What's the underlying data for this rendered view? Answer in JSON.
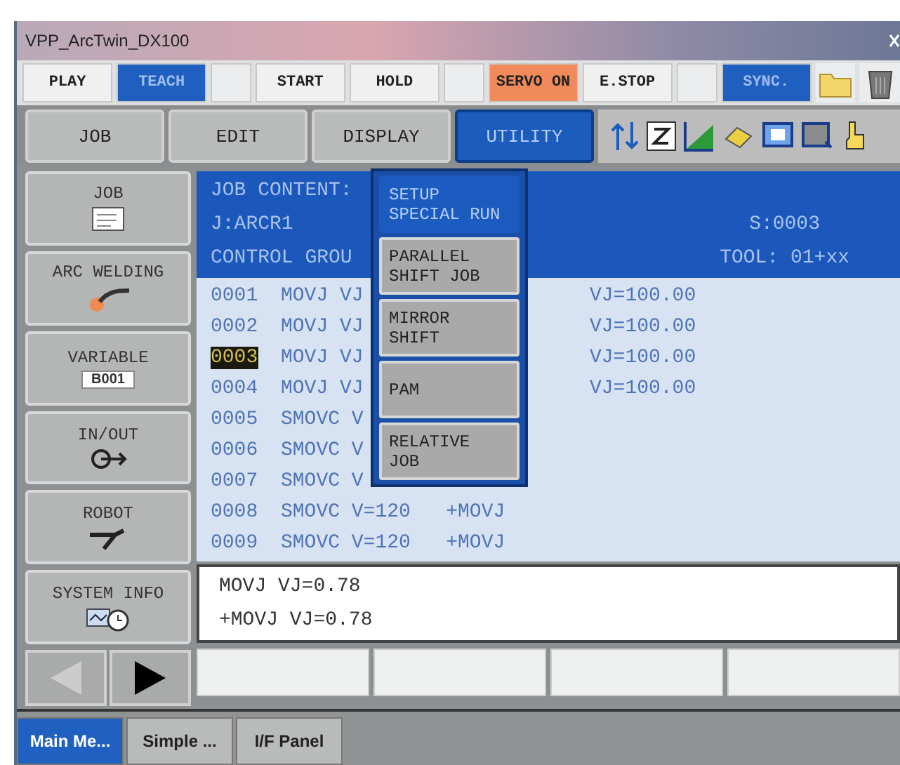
{
  "window": {
    "title": "VPP_ArcTwin_DX100"
  },
  "status_buttons": [
    {
      "kind": "plain",
      "label": "PLAY",
      "selected": false
    },
    {
      "kind": "plain",
      "label": "TEACH",
      "selected": true
    },
    {
      "kind": "spacer"
    },
    {
      "kind": "plain",
      "label": "START",
      "selected": false
    },
    {
      "kind": "plain",
      "label": "HOLD",
      "selected": false
    },
    {
      "kind": "spacer"
    },
    {
      "kind": "servo",
      "label": "SERVO ON",
      "selected": true
    },
    {
      "kind": "plain",
      "label": "E.STOP",
      "selected": false
    },
    {
      "kind": "spacer"
    },
    {
      "kind": "plain",
      "label": "SYNC.",
      "selected": true
    },
    {
      "kind": "folder"
    },
    {
      "kind": "bin"
    }
  ],
  "menu_tabs": [
    {
      "label": "JOB",
      "selected": false
    },
    {
      "label": "EDIT",
      "selected": false
    },
    {
      "label": "DISPLAY",
      "selected": false
    },
    {
      "label": "UTILITY",
      "selected": true
    }
  ],
  "side_buttons": [
    {
      "kind": "job",
      "label": "JOB"
    },
    {
      "kind": "arc",
      "label": "ARC WELDING"
    },
    {
      "kind": "variable",
      "label": "VARIABLE",
      "badge": "B001"
    },
    {
      "kind": "inout",
      "label": "IN/OUT"
    },
    {
      "kind": "robot",
      "label": "ROBOT"
    },
    {
      "kind": "sysinfo",
      "label": "SYSTEM INFO"
    }
  ],
  "job": {
    "header_left": [
      "JOB CONTENT:",
      "J:ARCR1",
      "CONTROL GROU"
    ],
    "header_right": [
      "S:0003",
      "TOOL: 01+xx"
    ],
    "lines": [
      {
        "number": "0001",
        "text": "MOVJ VJ",
        "tail": "VJ=100.00",
        "selected": false
      },
      {
        "number": "0002",
        "text": "MOVJ VJ",
        "tail": "VJ=100.00",
        "selected": false
      },
      {
        "number": "0003",
        "text": "MOVJ VJ",
        "tail": "VJ=100.00",
        "selected": true
      },
      {
        "number": "0004",
        "text": "MOVJ VJ",
        "tail": "VJ=100.00",
        "selected": false
      },
      {
        "number": "0005",
        "text": "SMOVC V",
        "selected": false
      },
      {
        "number": "0006",
        "text": "SMOVC V",
        "selected": false
      },
      {
        "number": "0007",
        "text": "SMOVC V",
        "selected": false
      },
      {
        "number": "0008",
        "text": "SMOVC V=120   +MOVJ",
        "selected": false
      },
      {
        "number": "0009",
        "text": "SMOVC V=120   +MOVJ",
        "selected": false
      }
    ]
  },
  "utility_menu": [
    {
      "label": "SETUP\nSPECIAL RUN",
      "selected": true
    },
    {
      "label": "PARALLEL\nSHIFT JOB",
      "selected": false
    },
    {
      "label": "MIRROR\nSHIFT",
      "selected": false
    },
    {
      "label": "PAM",
      "selected": false
    },
    {
      "label": "RELATIVE\nJOB",
      "selected": false
    }
  ],
  "input_lines": [
    "MOVJ VJ=0.78",
    "+MOVJ VJ=0.78"
  ],
  "taskbar": [
    {
      "label": "Main Me...",
      "selected": true
    },
    {
      "label": "Simple ...",
      "selected": false
    },
    {
      "label": "I/F Panel",
      "selected": false
    }
  ]
}
